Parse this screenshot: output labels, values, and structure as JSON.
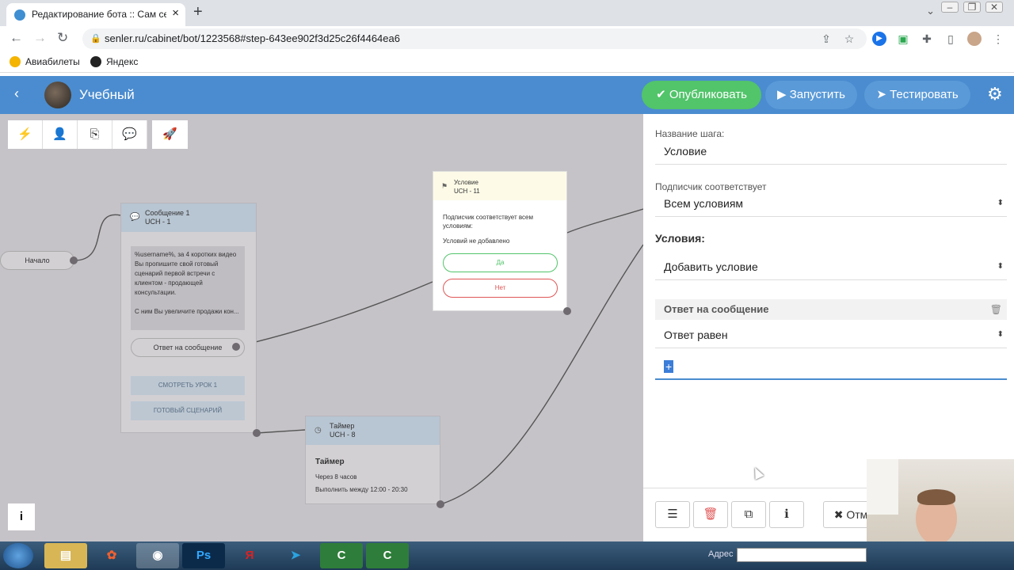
{
  "browser": {
    "tab_title": "Редактирование бота :: Сам себ",
    "url": "senler.ru/cabinet/bot/1223568#step-643ee902f3d25c26f4464ea6",
    "bookmarks": [
      "Авиабилеты",
      "Яндекс"
    ]
  },
  "header": {
    "bot_name": "Учебный",
    "publish_label": "Опубликовать",
    "run_label": "Запустить",
    "test_label": "Тестировать"
  },
  "canvas": {
    "start_label": "Начало",
    "message_node": {
      "title": "Сообщение 1",
      "uid": "UCH - 1",
      "text": "%username%, за 4 коротких видео Вы пропишите свой готовый сценарий первой встречи с клиентом - продающей консультации.\n\nС ним Вы увеличите продажи кон...",
      "answer_label": "Ответ на сообщение",
      "button1": "СМОТРЕТЬ УРОК 1",
      "button2": "ГОТОВЫЙ СЦЕНАРИЙ"
    },
    "timer_node": {
      "title": "Таймер",
      "uid": "UCH - 8",
      "heading": "Таймер",
      "line1": "Через 8 часов",
      "line2": "Выполнить между 12:00 - 20:30"
    },
    "condition_node": {
      "title": "Условие",
      "uid": "UCH - 11",
      "text": "Подписчик соответствует всем условиям:",
      "empty": "Условий не добавлено",
      "yes": "Да",
      "no": "Нет"
    }
  },
  "panel": {
    "step_name_label": "Название шага:",
    "step_name_value": "Условие",
    "subscriber_label": "Подписчик соответствует",
    "subscriber_value": "Всем условиям",
    "conditions_label": "Условия:",
    "add_condition": "Добавить условие",
    "condition_block_title": "Ответ на сообщение",
    "answer_operator": "Ответ равен",
    "answer_value": "+",
    "cancel_label": "Отм"
  },
  "taskbar": {
    "address_label": "Адрес"
  }
}
